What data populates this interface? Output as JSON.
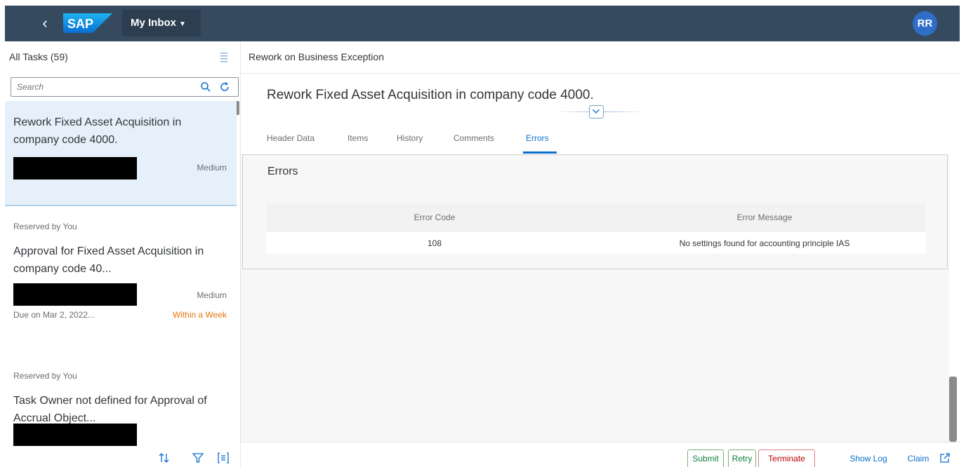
{
  "shell": {
    "logo_text": "SAP",
    "app_title": "My Inbox",
    "avatar_initials": "RR"
  },
  "master": {
    "title": "All Tasks (59)",
    "search_placeholder": "Search",
    "tasks": [
      {
        "title": "Rework Fixed Asset Acquisition in company code 4000.",
        "priority": "Medium"
      },
      {
        "status": "Reserved by You",
        "title": "Approval for Fixed Asset Acquisition in company code 40...",
        "priority": "Medium",
        "due": "Due on Mar 2, 2022...",
        "due_label": "Within a Week"
      },
      {
        "status": "Reserved by You",
        "title": "Task Owner not defined for Approval of Accrual Object..."
      }
    ]
  },
  "detail": {
    "header_title": "Rework on Business Exception",
    "object_title": "Rework Fixed Asset Acquisition in company code 4000.",
    "tabs": [
      "Header Data",
      "Items",
      "History",
      "Comments",
      "Errors"
    ],
    "active_tab": "Errors",
    "errors_section": {
      "title": "Errors",
      "columns": [
        "Error Code",
        "Error Message"
      ],
      "rows": [
        {
          "code": "108",
          "message": "No settings found for accounting principle IAS"
        }
      ]
    }
  },
  "footer": {
    "submit": "Submit",
    "retry": "Retry",
    "terminate": "Terminate",
    "show_log": "Show Log",
    "claim": "Claim"
  },
  "colors": {
    "shell_bg": "#354a5f",
    "selected_item_bg": "#e5f0fa",
    "accent": "#0a6ed1",
    "warning": "#e9730c",
    "accept": "#107e3e",
    "reject": "#bb0000"
  },
  "icons": {
    "back": "chevron-left-icon",
    "app_menu": "caret-down-icon",
    "sort": "sort-list-icon",
    "search": "search-icon",
    "refresh": "refresh-icon",
    "collapse": "chevron-down-icon",
    "footer_sort": "sort-icon",
    "footer_filter": "filter-icon",
    "footer_group": "group-icon",
    "open_external": "open-external-icon"
  }
}
